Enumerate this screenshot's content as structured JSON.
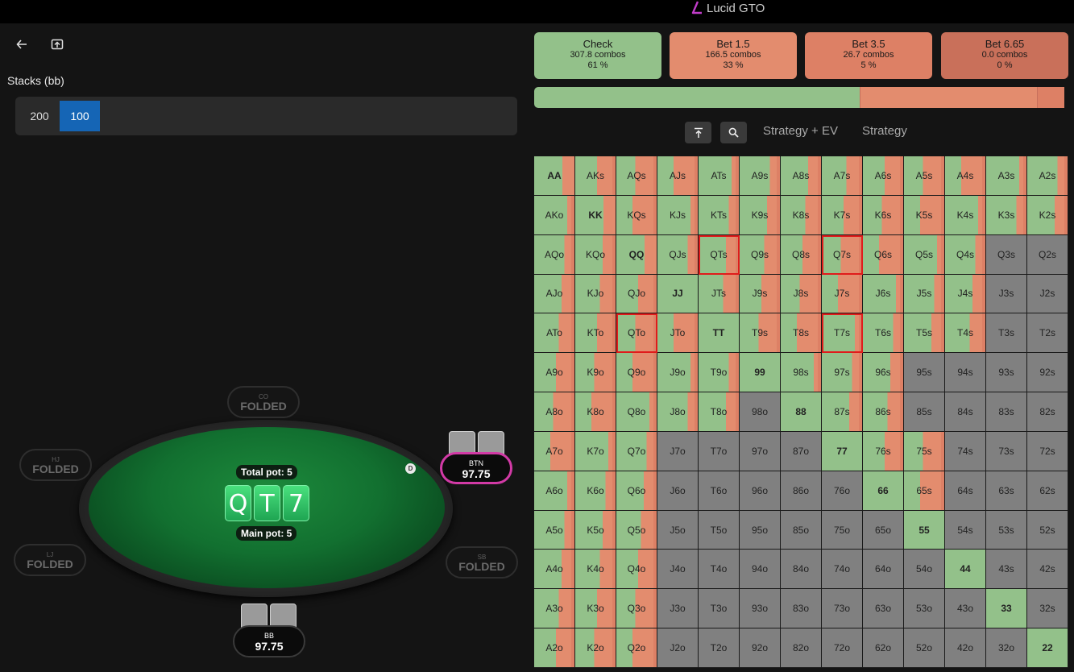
{
  "app": {
    "title": "Lucid GTO"
  },
  "toolbar": {
    "back_icon": "arrow-left-icon",
    "export_icon": "export-icon"
  },
  "stacks": {
    "label": "Stacks (bb)",
    "options": [
      "200",
      "100"
    ],
    "selected": "100"
  },
  "colors": {
    "check": "#93c18a",
    "bet_small": "#e38c6e",
    "bet_mid": "#dd8065",
    "bet_big": "#c9705a",
    "fold": "#808080",
    "highlight": "#e01b1b",
    "btn_ring": "#d23aa6"
  },
  "table": {
    "total_pot": "Total pot: 5",
    "main_pot": "Main pot: 5",
    "board": [
      "Q",
      "T",
      "7"
    ],
    "dealer_button": "D",
    "seats": {
      "co": {
        "pos": "CO",
        "status": "FOLDED"
      },
      "hj": {
        "pos": "HJ",
        "status": "FOLDED"
      },
      "lj": {
        "pos": "LJ",
        "status": "FOLDED"
      },
      "sb": {
        "pos": "SB",
        "status": "FOLDED"
      },
      "btn": {
        "pos": "BTN",
        "stack": "97.75"
      },
      "bb": {
        "pos": "BB",
        "stack": "97.75"
      }
    }
  },
  "actions": [
    {
      "name": "Check",
      "combos": "307.8 combos",
      "pct": "61 %",
      "color": "#93c18a",
      "freq": 61
    },
    {
      "name": "Bet 1.5",
      "combos": "166.5 combos",
      "pct": "33 %",
      "color": "#e38c6e",
      "freq": 33
    },
    {
      "name": "Bet 3.5",
      "combos": "26.7 combos",
      "pct": "5 %",
      "color": "#dd8065",
      "freq": 5
    },
    {
      "name": "Bet 6.65",
      "combos": "0.0 combos",
      "pct": "0 %",
      "color": "#c9705a",
      "freq": 0
    }
  ],
  "view": {
    "tabs": [
      "Strategy + EV",
      "Strategy"
    ],
    "icons": [
      "align-top-icon",
      "search-icon"
    ]
  },
  "grid": {
    "ranks": [
      "A",
      "K",
      "Q",
      "J",
      "T",
      "9",
      "8",
      "7",
      "6",
      "5",
      "4",
      "3",
      "2"
    ],
    "highlighted": [
      "QTs",
      "Q7s",
      "QTo",
      "T7s"
    ]
  }
}
